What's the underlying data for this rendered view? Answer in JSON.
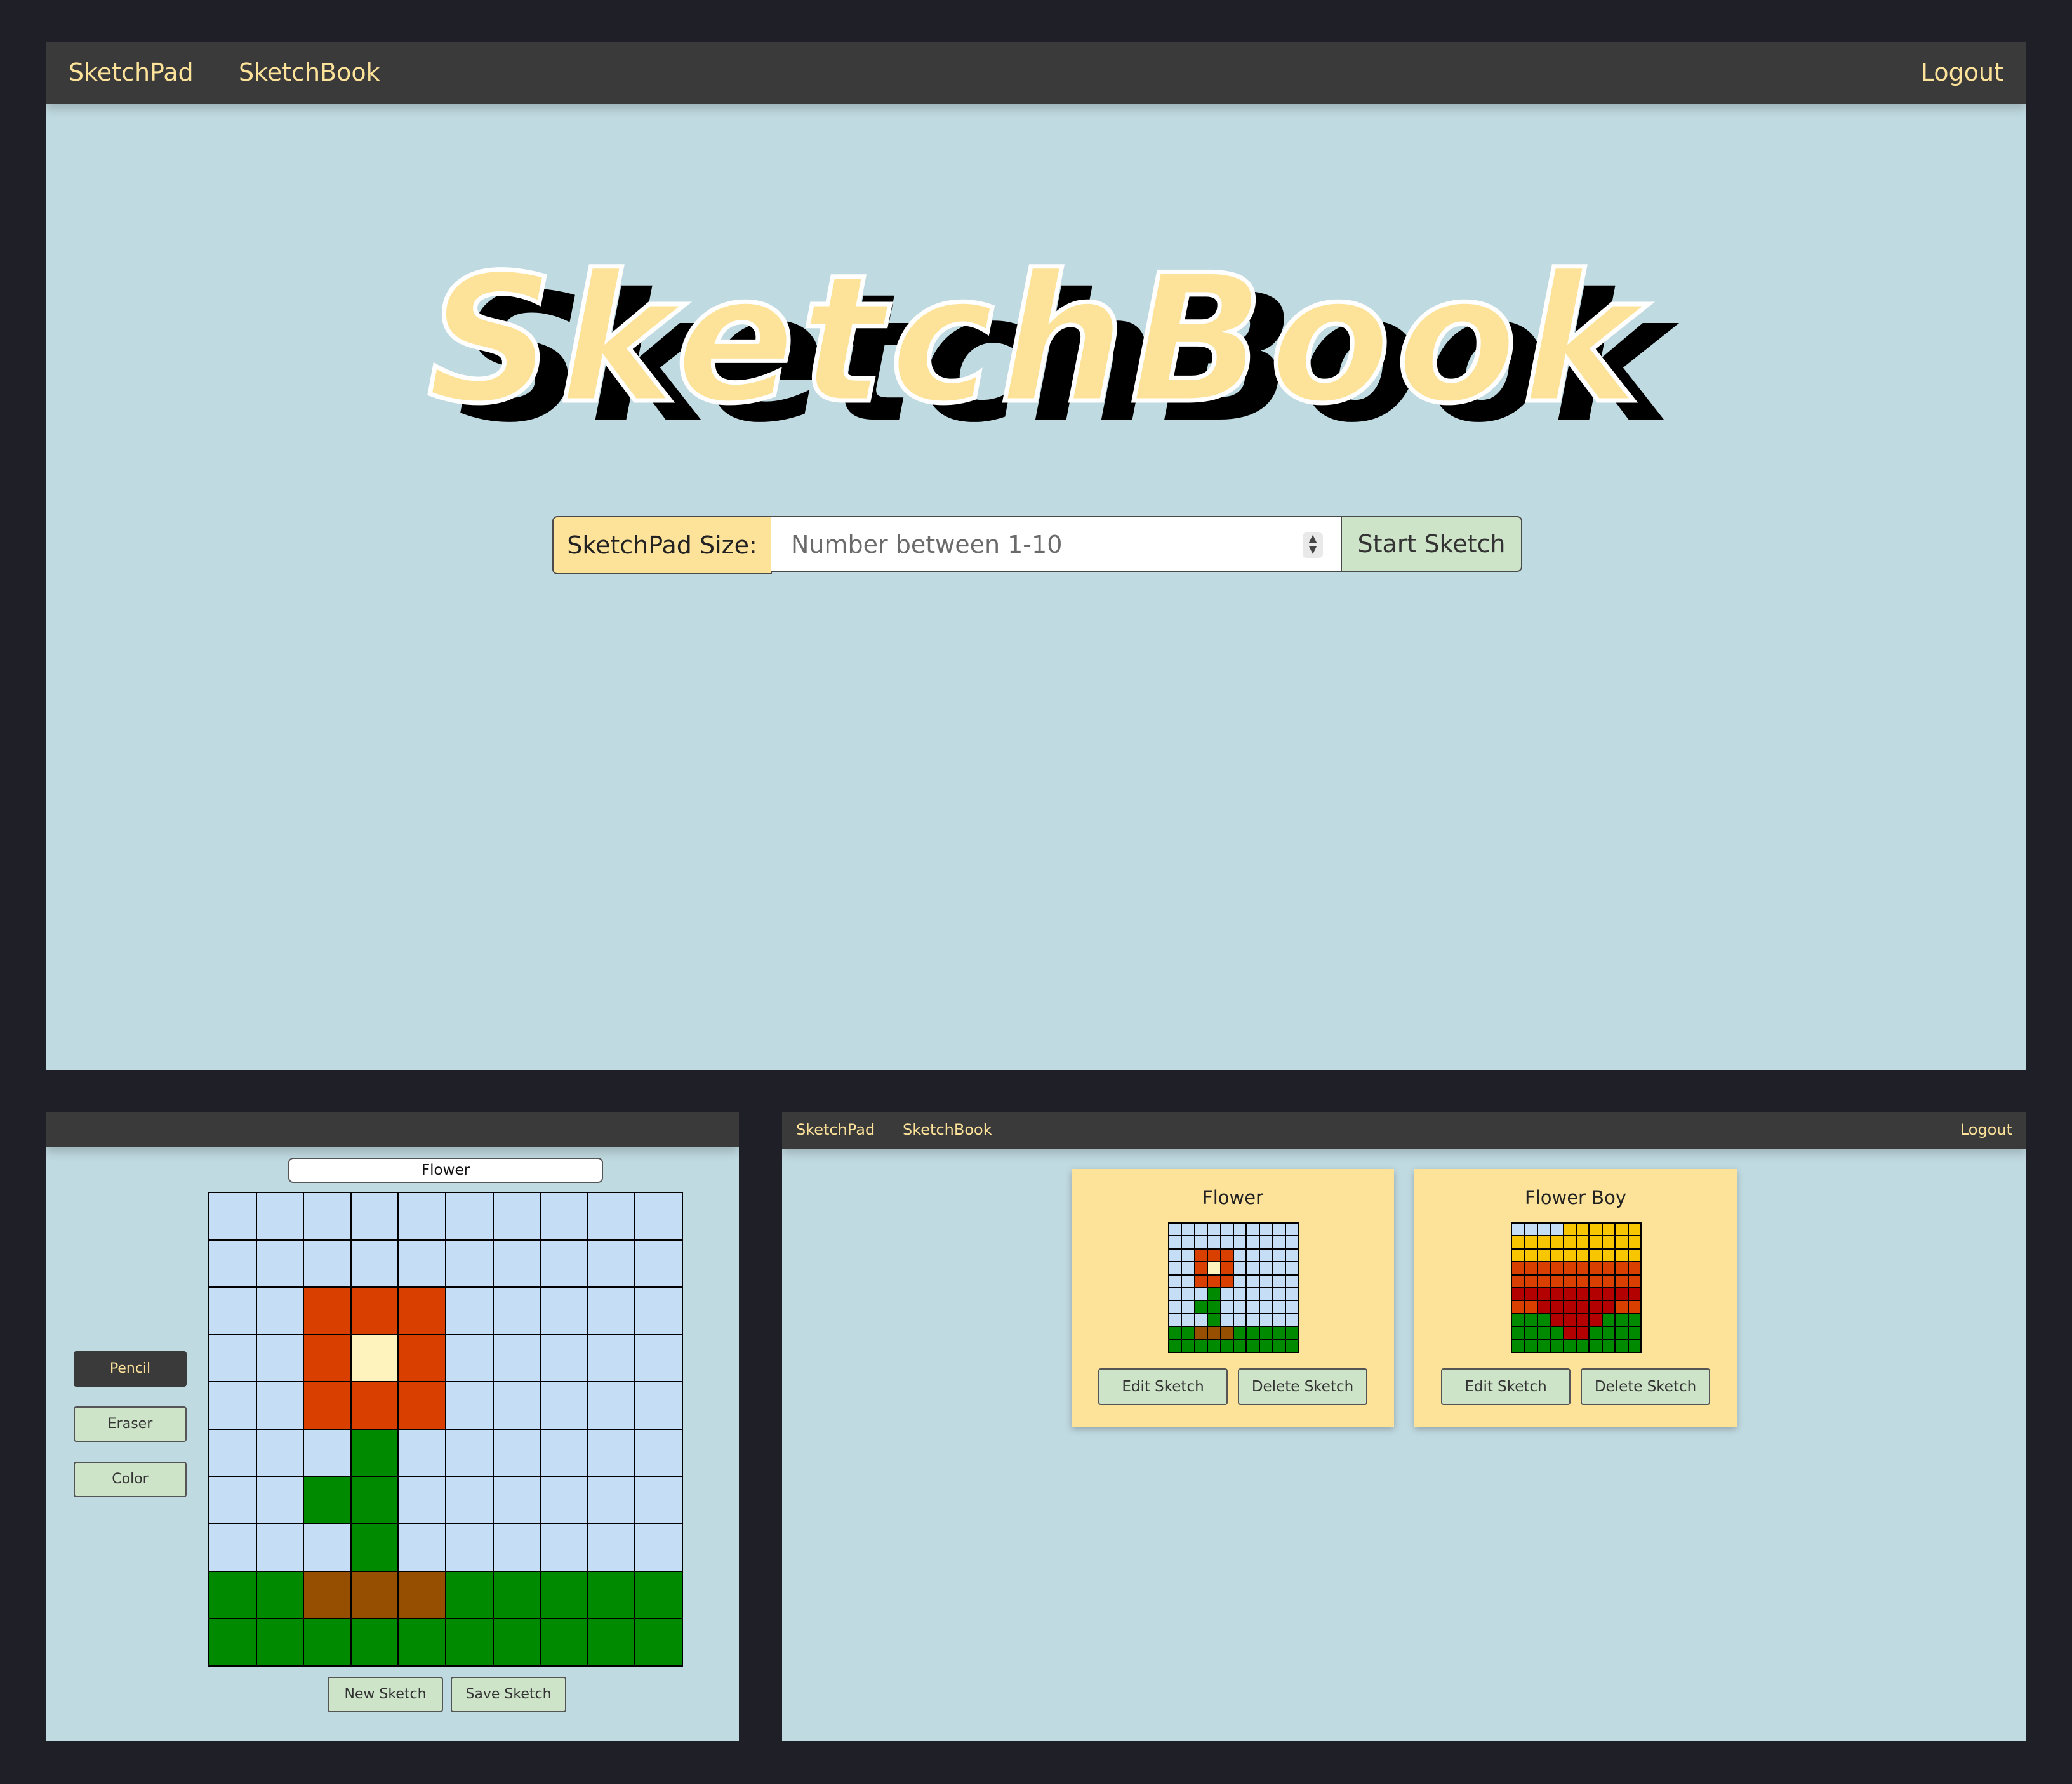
{
  "nav": {
    "sketchpad": "SketchPad",
    "sketchbook": "SketchBook",
    "logout": "Logout"
  },
  "hero": {
    "title": "SketchBook"
  },
  "size_form": {
    "label": "SketchPad Size:",
    "placeholder": "Number between 1-10",
    "value": "",
    "start_button": "Start Sketch",
    "spinner_up": "▲",
    "spinner_down": "▼"
  },
  "colors": {
    "sky": "#c5def5",
    "petal": "#d94000",
    "center": "#fff3bd",
    "stem": "#008a00",
    "soil": "#964e00",
    "sun": "#f7c600",
    "dark_red": "#b30000",
    "accent": "#fde39a",
    "navbar": "#3a3a3a",
    "button": "#cde4c9"
  },
  "editor": {
    "sketch_name": "Flower",
    "tools": [
      "Pencil",
      "Eraser",
      "Color"
    ],
    "active_tool": "Pencil",
    "new_button": "New Sketch",
    "save_button": "Save Sketch",
    "grid_size": 10,
    "grid": [
      "SSSSSSSSSS",
      "SSSSSSSSSS",
      "SSRRRSSSSS",
      "SSRCRSSSSS",
      "SSRRRSSSSS",
      "SSSGSSSSSS",
      "SSGGSSSSSS",
      "SSSGSSSSSS",
      "GGBBBGGGGG",
      "GGGGGGGGGG"
    ]
  },
  "gallery": {
    "sketches": [
      {
        "title": "Flower",
        "edit_button": "Edit Sketch",
        "delete_button": "Delete Sketch",
        "grid": [
          "SSSSSSSSSS",
          "SSSSSSSSSS",
          "SSRRRSSSSS",
          "SSRCRSSSSS",
          "SSRRRSSSSS",
          "SSSGSSSSSS",
          "SSGGSSSSSS",
          "SSSGSSSSSS",
          "GGBBBGGGGG",
          "GGGGGGGGGG"
        ]
      },
      {
        "title": "Flower Boy",
        "edit_button": "Edit Sketch",
        "delete_button": "Delete Sketch",
        "grid": [
          "SSSSYYYYYY",
          "YYYYYYYYYY",
          "YYYYYYYYYY",
          "RRRRRRRRRR",
          "RRRRRRRRRR",
          "DDDDDDDDDD",
          "RRDDDDDDRR",
          "GGGDDDDGGG",
          "GGGGDDGGGG",
          "GGGGGGGGGG"
        ]
      }
    ]
  }
}
